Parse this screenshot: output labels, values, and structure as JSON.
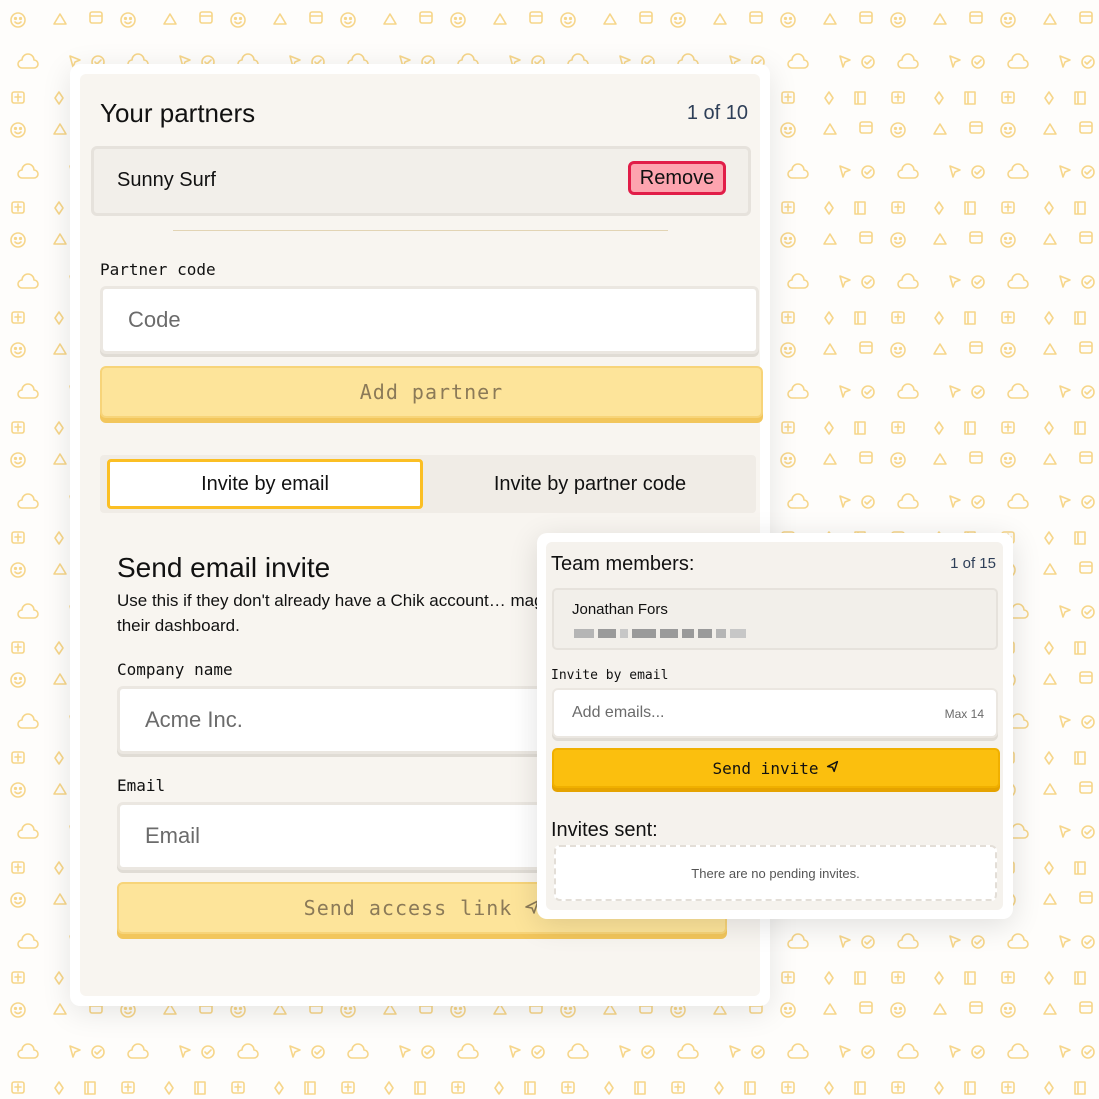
{
  "partners": {
    "title": "Your partners",
    "counter": "1 of 10",
    "items": [
      {
        "name": "Sunny Surf",
        "remove_label": "Remove"
      }
    ],
    "code_label": "Partner code",
    "code_placeholder": "Code",
    "add_button": "Add partner"
  },
  "tabs": [
    {
      "label": "Invite by email",
      "active": true
    },
    {
      "label": "Invite by partner code",
      "active": false
    }
  ],
  "email_invite": {
    "title": "Send email invite",
    "description": "Use this if they don't already have a Chik account… magic link to access their dashboard.",
    "company_label": "Company name",
    "company_placeholder": "Acme Inc.",
    "email_label": "Email",
    "email_placeholder": "Email",
    "send_button": "Send access link"
  },
  "team": {
    "title": "Team members:",
    "counter": "1 of 15",
    "members": [
      {
        "name": "Jonathan Fors"
      }
    ],
    "invite_label": "Invite by email",
    "emails_placeholder": "Add emails...",
    "max_hint": "Max 14",
    "send_button": "Send invite",
    "invites_title": "Invites sent:",
    "no_invites": "There are no pending invites."
  },
  "colors": {
    "accent": "#fbbf0e",
    "accent_light": "#fde49a",
    "danger_fill": "#fda4af",
    "danger_border": "#e11d48",
    "tab_active_border": "#fbbf24",
    "pattern": "#f6d68a"
  },
  "icons": {
    "send": "send-arrow-icon",
    "pattern": [
      "smiley-icon",
      "cloud-icon",
      "triangle-icon",
      "gift-icon",
      "cursor-icon",
      "book-icon",
      "check-circle-icon",
      "calendar-icon",
      "sparkle-icon"
    ]
  }
}
